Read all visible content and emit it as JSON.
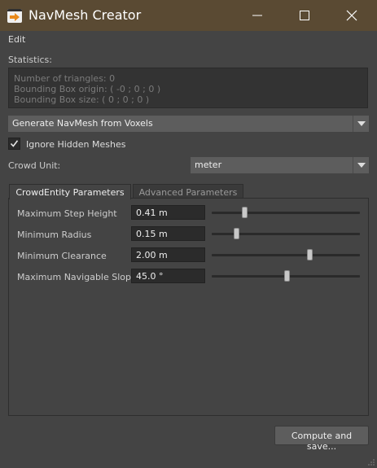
{
  "window": {
    "title": "NavMesh Creator"
  },
  "menu": {
    "edit": "Edit"
  },
  "statistics": {
    "label": "Statistics:",
    "lines": [
      "Number of triangles: 0",
      "Bounding Box origin: ( -0 ; 0 ; 0 )",
      "Bounding Box size: ( 0 ; 0 ; 0 )"
    ]
  },
  "method": {
    "selected": "Generate NavMesh from Voxels"
  },
  "ignore_hidden": {
    "label": "Ignore Hidden Meshes",
    "checked": true
  },
  "crowd_unit": {
    "label": "Crowd Unit:",
    "selected": "meter"
  },
  "tabs": [
    {
      "label": "CrowdEntity Parameters",
      "active": true
    },
    {
      "label": "Advanced Parameters",
      "active": false
    }
  ],
  "params": [
    {
      "label": "Maximum Step Height",
      "value": "0.41 m",
      "slider": 0.22
    },
    {
      "label": "Minimum Radius",
      "value": "0.15 m",
      "slider": 0.17
    },
    {
      "label": "Minimum Clearance",
      "value": "2.00 m",
      "slider": 0.66
    },
    {
      "label": "Maximum Navigable Slope",
      "value": "45.0 °",
      "slider": 0.51
    }
  ],
  "buttons": {
    "compute": "Compute and save..."
  },
  "colors": {
    "titlebar": "#5a4a33",
    "icon_accent": "#e88a1c",
    "background": "#444444"
  }
}
